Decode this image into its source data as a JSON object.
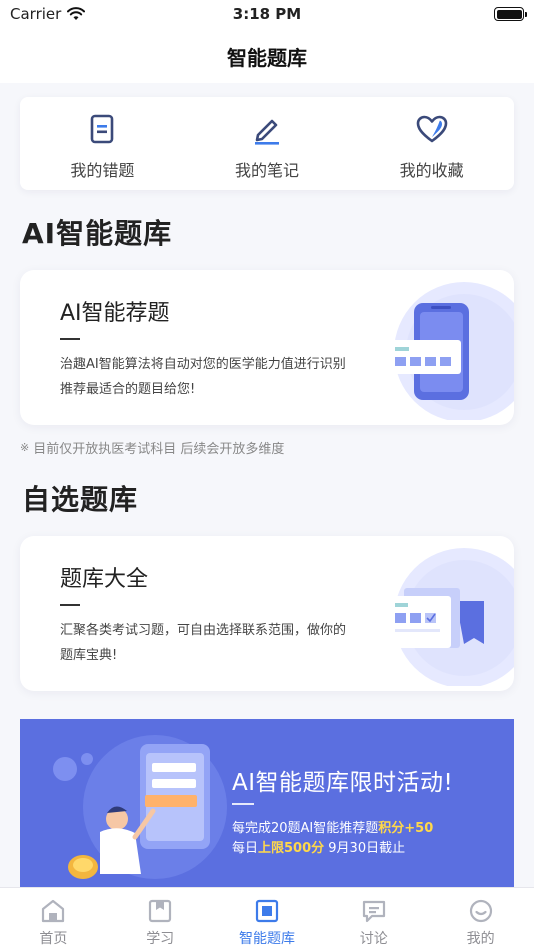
{
  "status_bar": {
    "carrier": "Carrier",
    "time": "3:18 PM"
  },
  "nav": {
    "title": "智能题库"
  },
  "quick_links": [
    {
      "label": "我的错题",
      "icon": "wrong-questions-icon"
    },
    {
      "label": "我的笔记",
      "icon": "notes-pen-icon"
    },
    {
      "label": "我的收藏",
      "icon": "favorites-heart-icon"
    }
  ],
  "ai_section": {
    "heading": "AI智能题库",
    "card": {
      "title": "AI智能荐题",
      "description": "治趣AI智能算法将自动对您的医学能力值进行识别推荐最适合的题目给您!"
    },
    "note": "目前仅开放执医考试科目 后续会开放多维度"
  },
  "custom_section": {
    "heading": "自选题库",
    "card": {
      "title": "题库大全",
      "description": "汇聚各类考试习题，可自由选择联系范围，做你的题库宝典!"
    }
  },
  "promo": {
    "title": "AI智能题库限时活动!",
    "line1_prefix": "每完成20题AI智能推荐题",
    "line1_highlight": "积分+50",
    "line2_prefix": "每日",
    "line2_highlight": "上限500分",
    "line2_suffix": " 9月30日截止"
  },
  "tabs": [
    {
      "label": "首页",
      "icon": "home-icon"
    },
    {
      "label": "学习",
      "icon": "study-book-icon"
    },
    {
      "label": "智能题库",
      "icon": "question-bank-icon",
      "active": true
    },
    {
      "label": "讨论",
      "icon": "discussion-icon"
    },
    {
      "label": "我的",
      "icon": "profile-icon"
    }
  ],
  "colors": {
    "accent": "#3d7bea",
    "promo_bg": "#5b6fe0",
    "highlight": "#ffd84a",
    "icon_navy": "#3b4a7a",
    "icon_blue": "#3d7bea"
  }
}
